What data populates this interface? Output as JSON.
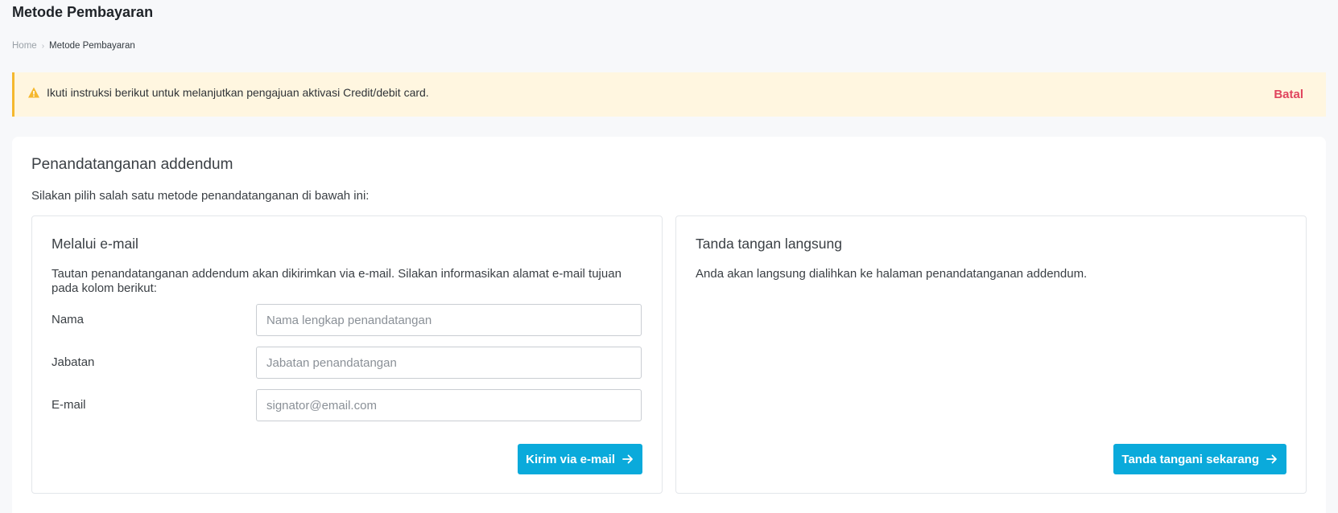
{
  "header": {
    "title": "Metode Pembayaran"
  },
  "breadcrumb": {
    "home": "Home",
    "separator": "›",
    "current": "Metode Pembayaran"
  },
  "alert": {
    "icon": "warning-icon",
    "text": "Ikuti instruksi berikut untuk melanjutkan pengajuan aktivasi Credit/debit card.",
    "cancel_label": "Batal"
  },
  "main": {
    "title": "Penandatanganan addendum",
    "description": "Silakan pilih salah satu metode penandatanganan di bawah ini:",
    "email_option": {
      "title": "Melalui e-mail",
      "description": "Tautan penandatanganan addendum akan dikirimkan via e-mail. Silakan informasikan alamat e-mail tujuan pada kolom berikut:",
      "fields": {
        "name": {
          "label": "Nama",
          "placeholder": "Nama lengkap penandatangan",
          "value": ""
        },
        "position": {
          "label": "Jabatan",
          "placeholder": "Jabatan penandatangan",
          "value": ""
        },
        "email": {
          "label": "E-mail",
          "placeholder": "signator@email.com",
          "value": ""
        }
      },
      "button_label": "Kirim via e-mail"
    },
    "direct_option": {
      "title": "Tanda tangan langsung",
      "description": "Anda akan langsung dialihkan ke halaman penandatanganan addendum.",
      "button_label": "Tanda tangani sekarang"
    }
  },
  "colors": {
    "accent": "#0aaadb",
    "alert_bg": "#fff6e0",
    "alert_border": "#f5b82e",
    "cancel": "#e0455e"
  }
}
